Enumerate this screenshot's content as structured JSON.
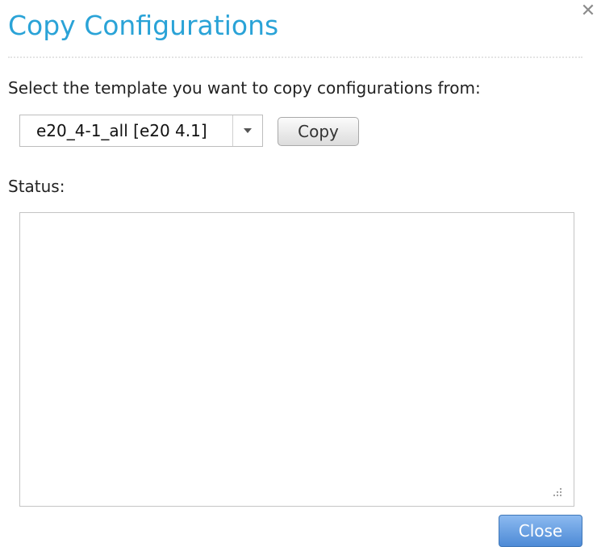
{
  "dialog": {
    "title": "Copy Configurations",
    "close_icon": "close-icon"
  },
  "template_select": {
    "prompt": "Select the template you want to copy configurations from:",
    "selected_value": "e20_4-1_all [e20 4.1]",
    "arrow_icon": "chevron-down-icon"
  },
  "actions": {
    "copy_label": "Copy",
    "close_label": "Close"
  },
  "status": {
    "label": "Status:",
    "text": "",
    "resize_icon": "resize-grip-icon"
  },
  "colors": {
    "title": "#2aa3d7",
    "close_button": "#5b95dc"
  }
}
